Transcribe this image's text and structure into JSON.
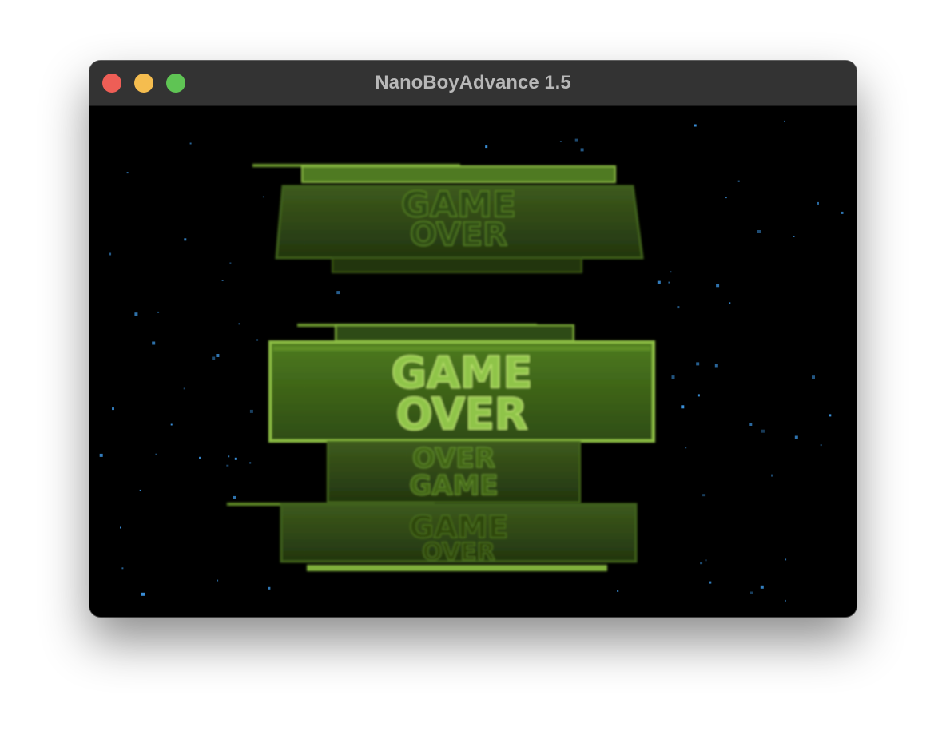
{
  "window": {
    "title": "NanoBoyAdvance 1.5"
  },
  "game_screen": {
    "plates": [
      {
        "line1": "GAME",
        "line2": "OVER"
      },
      {
        "line1": "GAME",
        "line2": "OVER"
      },
      {
        "line1": "OVER",
        "line2": "GAME"
      },
      {
        "line1": "GAME",
        "line2": "OVER"
      }
    ]
  },
  "colors": {
    "close": "#ee5e56",
    "minimize": "#f5bd4f",
    "zoom": "#5fc454",
    "plate_green": "#7fb03a",
    "star_blue": "#3a8fd8"
  }
}
